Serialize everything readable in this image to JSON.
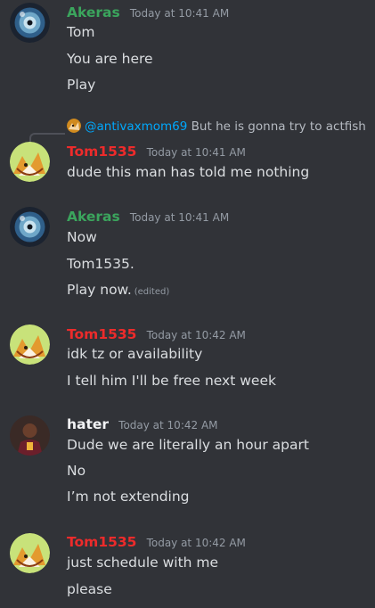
{
  "colors": {
    "background": "#313338",
    "text": "#dbdee1",
    "muted": "#949ba4",
    "akeras": "#3ba55d",
    "tom": "#ed2b2b",
    "hater": "#f2f3f5",
    "mention": "#00a8fc"
  },
  "messages": [
    {
      "username": "Akeras",
      "timestamp": "Today at 10:41 AM",
      "avatar_icon": "planet-avatar-icon",
      "lines": [
        "Tom",
        "You are here",
        "Play"
      ]
    },
    {
      "reply": {
        "avatar_icon": "fox-mini-avatar-icon",
        "mention": "@antivaxmom69",
        "text": "But he is gonna try to actfish"
      },
      "username": "Tom1535",
      "timestamp": "Today at 10:41 AM",
      "avatar_icon": "fox-avatar-icon",
      "lines": [
        "dude this man has told me nothing"
      ]
    },
    {
      "username": "Akeras",
      "timestamp": "Today at 10:41 AM",
      "avatar_icon": "planet-avatar-icon",
      "lines": [
        "Now",
        "Tom1535.",
        "Play now."
      ],
      "edited": "(edited)"
    },
    {
      "username": "Tom1535",
      "timestamp": "Today at 10:42 AM",
      "avatar_icon": "fox-avatar-icon",
      "lines": [
        "idk tz or availability",
        "I tell him I'll be free next week"
      ]
    },
    {
      "username": "hater",
      "timestamp": "Today at 10:42 AM",
      "avatar_icon": "player-avatar-icon",
      "lines": [
        "Dude we are literally an hour apart",
        "No",
        "I’m not extending"
      ]
    },
    {
      "username": "Tom1535",
      "timestamp": "Today at 10:42 AM",
      "avatar_icon": "fox-avatar-icon",
      "lines": [
        "just schedule with me",
        "please"
      ]
    }
  ]
}
